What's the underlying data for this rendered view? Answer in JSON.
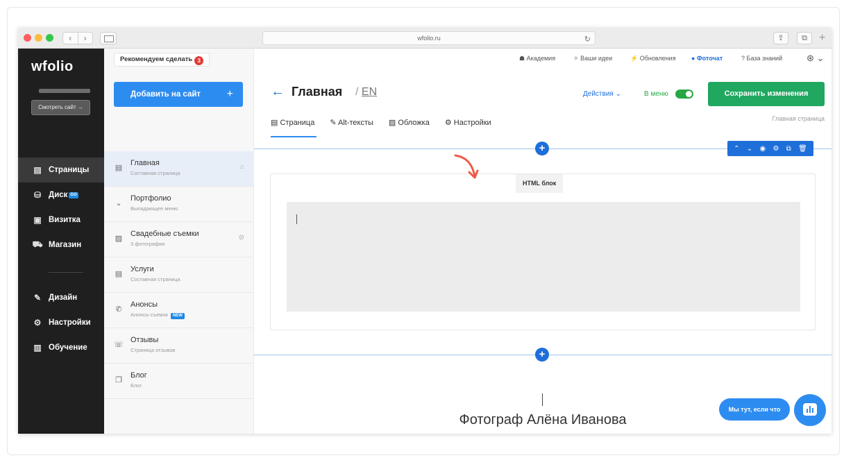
{
  "browser": {
    "url": "wfolio.ru",
    "nav_back": "‹",
    "nav_forward": "›",
    "reload": "↻",
    "share": "⇪",
    "tabs": "⧉",
    "new_tab": "+"
  },
  "sidebar": {
    "logo": "wfolio",
    "view_site": "Смотреть сайт →",
    "items": [
      {
        "label": "Страницы",
        "icon": "page-icon",
        "glyph": "▤",
        "active": true
      },
      {
        "label": "Диск",
        "icon": "disk-icon",
        "glyph": "⛁",
        "badge": "GO"
      },
      {
        "label": "Визитка",
        "icon": "card-icon",
        "glyph": "▣"
      },
      {
        "label": "Магазин",
        "icon": "cart-icon",
        "glyph": "⛟"
      },
      {
        "label": "Дизайн",
        "icon": "brush-icon",
        "glyph": "✎"
      },
      {
        "label": "Настройки",
        "icon": "gear-icon",
        "glyph": "⚙"
      },
      {
        "label": "Обучение",
        "icon": "book-icon",
        "glyph": "▥"
      }
    ]
  },
  "pages_panel": {
    "recommend_label": "Рекомендуем сделать",
    "recommend_count": "3",
    "add_button": "Добавить на сайт",
    "add_plus": "+",
    "pages": [
      {
        "title": "Главная",
        "subtitle": "Составная страница",
        "icon": "page-icon",
        "glyph": "▤",
        "right": "⌂",
        "right_icon": "home-icon",
        "active": true
      },
      {
        "title": "Портфолио",
        "subtitle": "Выпадающее меню",
        "icon": "chevron-down-icon",
        "glyph": "⌄"
      },
      {
        "title": "Свадебные съемки",
        "subtitle": "3 фотографии",
        "icon": "image-icon",
        "glyph": "▨",
        "right": "⊘",
        "right_icon": "hidden-icon"
      },
      {
        "title": "Услуги",
        "subtitle": "Составная страница",
        "icon": "page-icon",
        "glyph": "▤"
      },
      {
        "title": "Анонсы",
        "subtitle": "Анонсы съемок",
        "icon": "megaphone-icon",
        "glyph": "✆",
        "badge": "NEW"
      },
      {
        "title": "Отзывы",
        "subtitle": "Страница отзывов",
        "icon": "chat-icon",
        "glyph": "☏"
      },
      {
        "title": "Блог",
        "subtitle": "Блог",
        "icon": "copy-icon",
        "glyph": "❐"
      }
    ]
  },
  "topbar": {
    "links": [
      {
        "label": "Академия",
        "icon": "academy-icon",
        "glyph": "☗"
      },
      {
        "label": "Ваши идеи",
        "icon": "lightbulb-icon",
        "glyph": "✧"
      },
      {
        "label": "Обновления",
        "icon": "bolt-icon",
        "glyph": "⚡"
      },
      {
        "label": "Фоточат",
        "icon": "photochat-icon",
        "glyph": "●"
      },
      {
        "label": "База знаний",
        "icon": "help-icon",
        "glyph": "?"
      }
    ],
    "avatar": "⊛ ⌄"
  },
  "editor": {
    "back_arrow": "←",
    "title": "Главная",
    "lang_sep": "/",
    "lang": "EN",
    "actions": "Действия ⌄",
    "in_menu": "В меню",
    "in_menu_on": true,
    "save": "Сохранить изменения",
    "page_type": "Главная страница",
    "tabs": [
      {
        "label": "Страница",
        "glyph": "▤",
        "icon": "page-icon"
      },
      {
        "label": "Alt-тексты",
        "glyph": "✎",
        "icon": "edit-icon"
      },
      {
        "label": "Обложка",
        "glyph": "▨",
        "icon": "image-icon"
      },
      {
        "label": "Настройки",
        "glyph": "⚙",
        "icon": "gear-icon"
      }
    ],
    "block_label": "HTML блок",
    "block_toolbar": [
      "⌃",
      "⌄",
      "◉",
      "⚙",
      "⧉",
      "🗑"
    ],
    "add_block": "+",
    "photographer_name": "Фотограф Алёна Иванова",
    "chat_pill": "Мы тут, если что"
  },
  "colors": {
    "accent_blue": "#2d8cf0",
    "save_green": "#20a760",
    "sidebar_dark": "#1f1f1f",
    "arrow_red": "#ee5a45"
  }
}
